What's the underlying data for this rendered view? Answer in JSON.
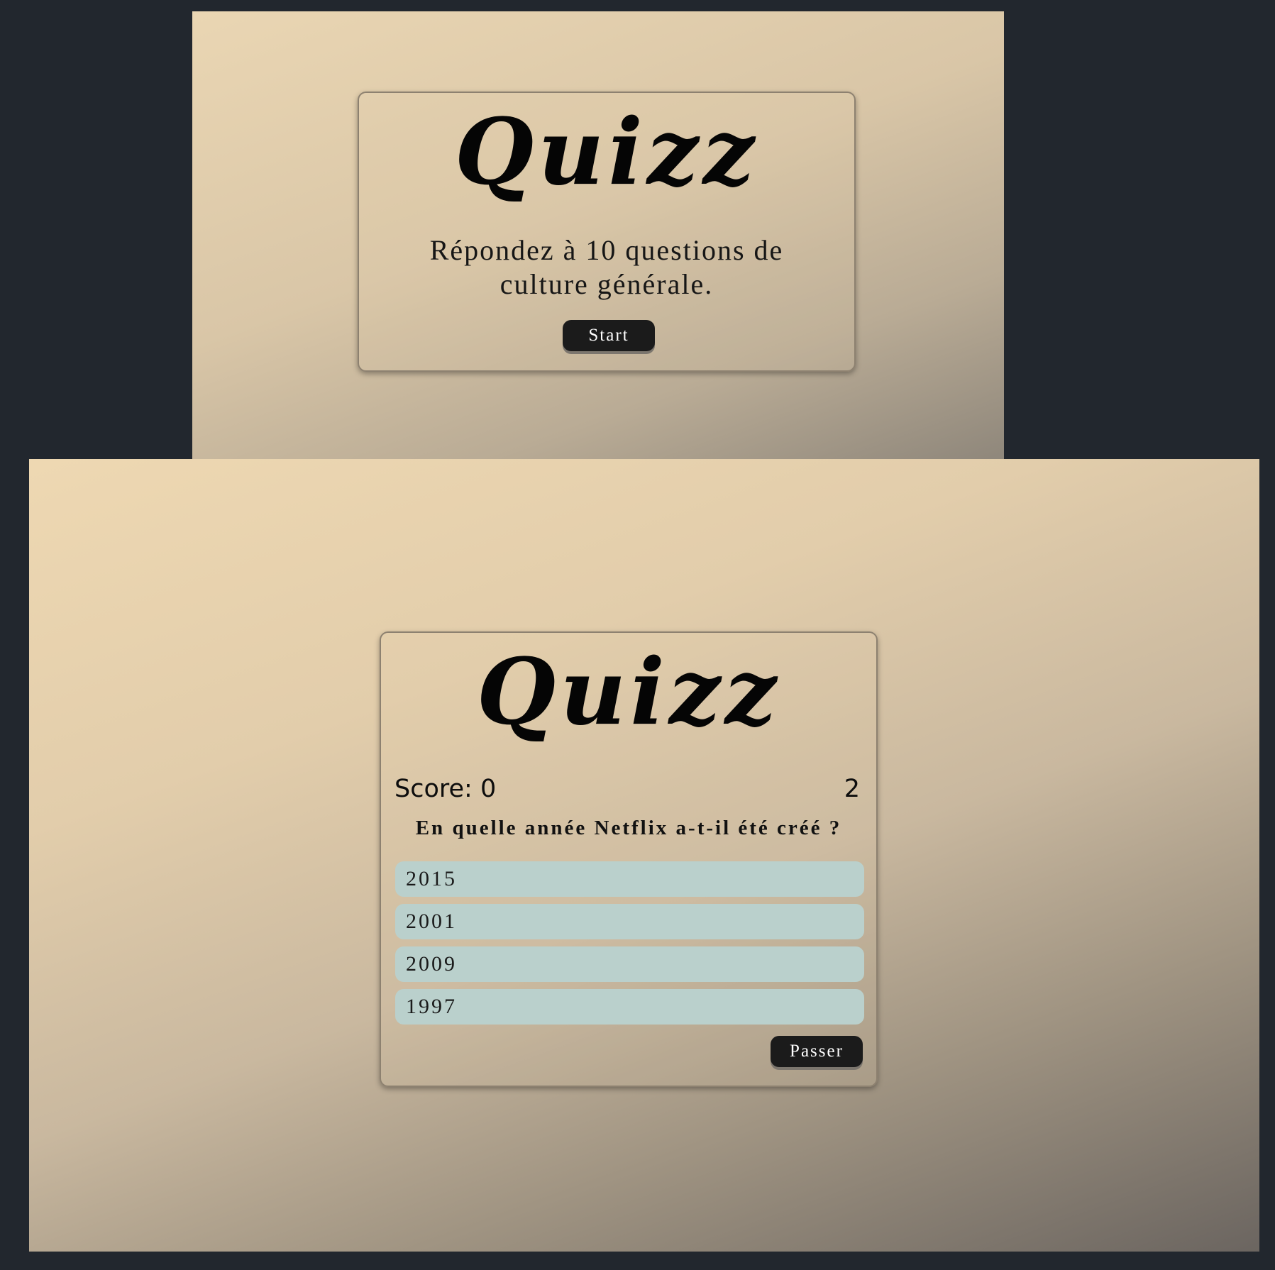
{
  "start_screen": {
    "logo": "Quizz",
    "intro": "Répondez à 10 questions de culture générale.",
    "start_label": "Start"
  },
  "question_screen": {
    "logo": "Quizz",
    "score_text": "Score: 0",
    "question_number": "2",
    "question": "En quelle année Netflix a-t-il été créé ?",
    "answers": [
      "2015",
      "2001",
      "2009",
      "1997"
    ],
    "skip_label": "Passer"
  },
  "colors": {
    "page_background": "#22272e",
    "button_background": "#1b1b1b",
    "answer_background": "#bad0cc"
  }
}
